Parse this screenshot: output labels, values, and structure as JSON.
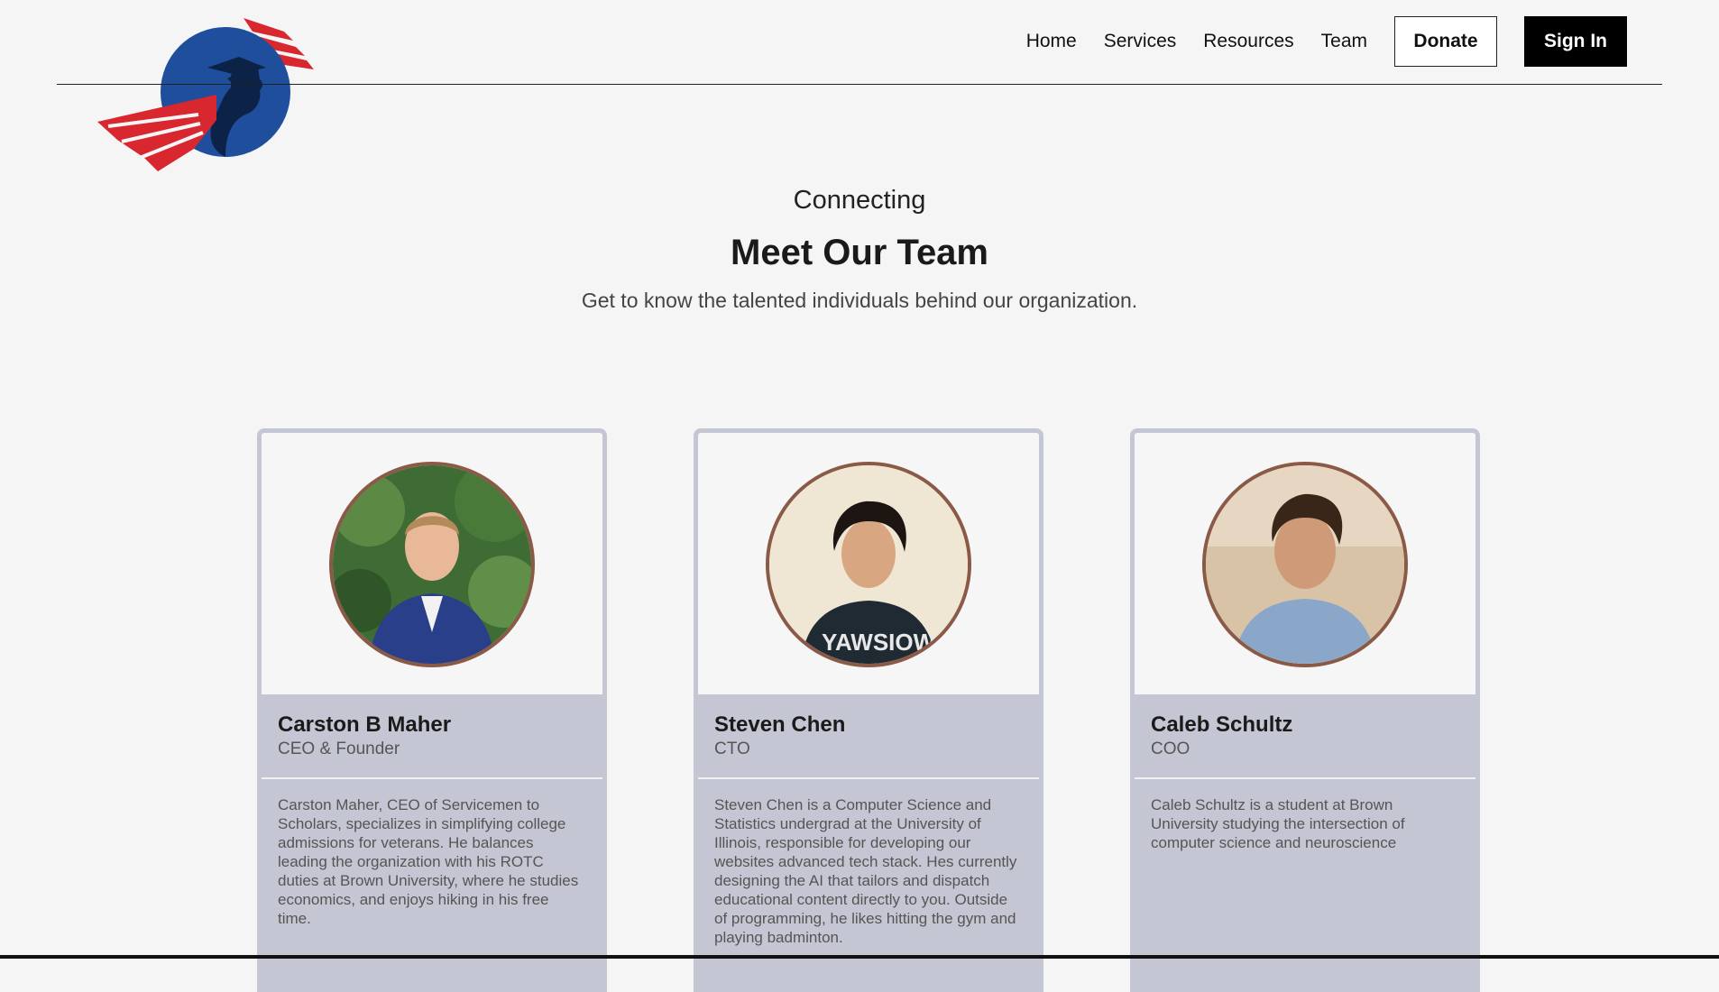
{
  "nav": {
    "links": [
      "Home",
      "Services",
      "Resources",
      "Team"
    ],
    "donate_label": "Donate",
    "signin_label": "Sign In"
  },
  "hero": {
    "eyebrow": "Connecting",
    "title": "Meet Our Team",
    "subtitle": "Get to know the talented individuals behind our organization."
  },
  "team": [
    {
      "name": "Carston B Maher",
      "role": "CEO & Founder",
      "bio": "Carston Maher, CEO of Servicemen to Scholars, specializes in simplifying college admissions for veterans. He balances leading the organization with his ROTC duties at Brown University, where he studies economics, and enjoys hiking in his free time."
    },
    {
      "name": "Steven Chen",
      "role": "CTO",
      "bio": "Steven Chen is a Computer Science and Statistics undergrad at the University of Illinois, responsible for developing our websites advanced tech stack. Hes currently designing the AI that tailors and dispatch educational content directly to you. Outside of programming, he likes hitting the gym and playing badminton."
    },
    {
      "name": "Caleb Schultz",
      "role": "COO",
      "bio": "Caleb Schultz is a student at Brown University studying the intersection of computer science and neuroscience"
    }
  ],
  "colors": {
    "background": "#f5f5f5",
    "card_panel": "#c5c6d3",
    "avatar_border": "#8b5a47",
    "logo_blue": "#1f4f9c",
    "logo_navy": "#0d2247",
    "logo_red": "#d8272f"
  }
}
